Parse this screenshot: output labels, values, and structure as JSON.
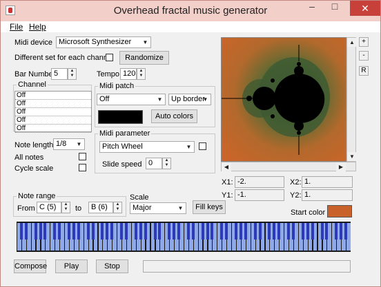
{
  "window": {
    "title": "Overhead fractal music generator",
    "minimize": "–",
    "maximize": "□",
    "close": "✕"
  },
  "menu": {
    "file": "File",
    "help": "Help"
  },
  "midi_device": {
    "label": "Midi device",
    "value": "Microsoft Synthesizer"
  },
  "different_set": {
    "label": "Different set for each channel",
    "checked": false
  },
  "randomize": "Randomize",
  "bar_number": {
    "label": "Bar Number",
    "value": "5"
  },
  "tempo": {
    "label": "Tempo",
    "value": "120"
  },
  "channel": {
    "label": "Channel",
    "items": [
      "Off",
      "Off",
      "Off",
      "Off",
      "Off"
    ]
  },
  "midi_patch": {
    "label": "Midi patch",
    "value": "Off",
    "border_mode": "Up border",
    "color": "#000000"
  },
  "auto_colors": "Auto colors",
  "note_length": {
    "label": "Note length",
    "value": "1/8"
  },
  "all_notes": {
    "label": "All notes",
    "checked": false
  },
  "cycle_scale": {
    "label": "Cycle scale",
    "checked": false
  },
  "midi_parameter": {
    "label": "Midi parameter",
    "value": "Pitch Wheel",
    "checked": false
  },
  "slide_speed": {
    "label": "Slide speed",
    "value": "0"
  },
  "coords": {
    "x1_label": "X1:",
    "x1": "-2.",
    "x2_label": "X2:",
    "x2": "1.",
    "y1_label": "Y1:",
    "y1": "-1.",
    "y2_label": "Y2:",
    "y2": "1."
  },
  "side_buttons": {
    "plus": "+",
    "minus": "-",
    "reset": "R"
  },
  "start_color": {
    "label": "Start color",
    "color": "#c8612a"
  },
  "note_range": {
    "label": "Note range",
    "from_label": "From",
    "from": "C (5)",
    "to_label": "to",
    "to": "B (6)"
  },
  "scale": {
    "label": "Scale",
    "value": "Major"
  },
  "fill_keys": "Fill keys",
  "keyboard": {
    "white_key_color": "#8fa8e8",
    "black_key_color": "#2c3ab8",
    "white_keys": 70
  },
  "buttons": {
    "compose": "Compose",
    "play": "Play",
    "stop": "Stop"
  },
  "status_text": ""
}
